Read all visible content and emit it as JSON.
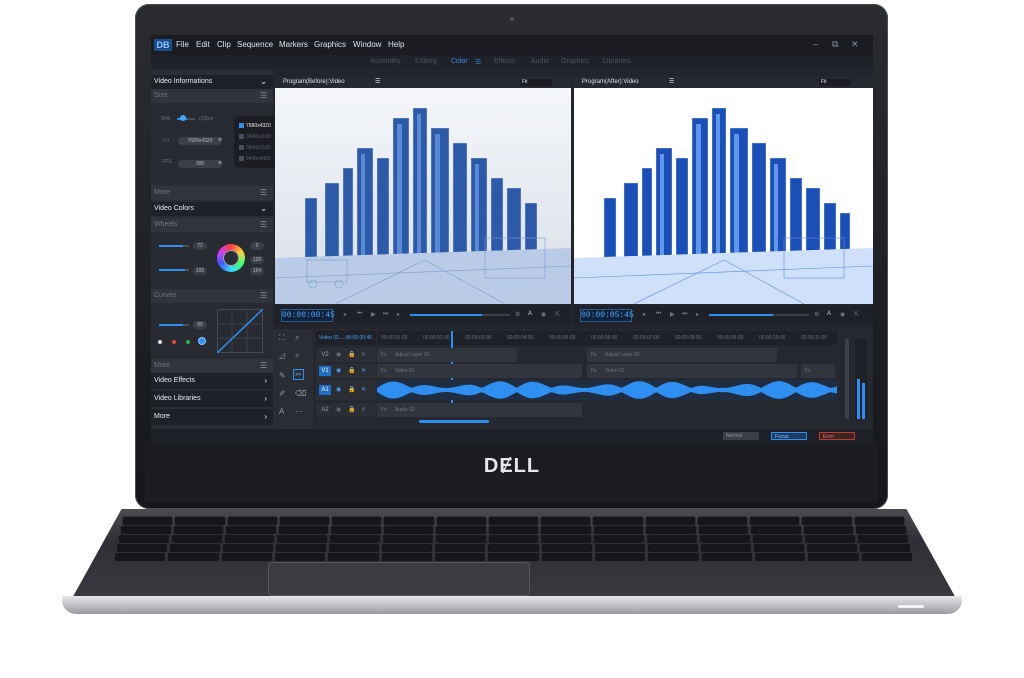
{
  "device": {
    "brand": "DɆLL"
  },
  "app": {
    "logo": "DB",
    "menu": [
      "File",
      "Edit",
      "Clip",
      "Sequence",
      "Markers",
      "Graphics",
      "Window",
      "Help"
    ],
    "window_controls": {
      "minimize": "–",
      "restore": "⧉",
      "close": "✕"
    }
  },
  "workspaces": {
    "tabs": [
      "Assembly",
      "Editing",
      "Color",
      "Effects",
      "Audio",
      "Graphics",
      "Libraries"
    ],
    "active": "Color"
  },
  "left_panel": {
    "video_informations": "Video Informations",
    "size_label": "Size",
    "toggle_left": "8/4k",
    "toggle_right": "(3)0ns",
    "resolution_value": "7680x4320",
    "fps_value": "300",
    "resolution_options": [
      "7680x4320",
      "3840x2160",
      "3840x2160",
      "5440x4400"
    ],
    "more_1": "More",
    "video_colors": "Video Colors",
    "wheels_label": "Wheels",
    "wheel_values": [
      "72",
      "0",
      "100",
      "120",
      "164"
    ],
    "curves_label": "Curves",
    "curve_value": "80",
    "more_2": "More",
    "video_effects": "Video Effects",
    "video_libraries": "Video Libraries",
    "more_3": "More"
  },
  "monitors": {
    "before": {
      "title": "Program(Before):Video",
      "fit": "Fit",
      "timecode": "00:00:00:45"
    },
    "after": {
      "title": "Program(After):Video",
      "fit": "Fit",
      "timecode": "00:00:05:45"
    }
  },
  "timeline": {
    "sequence_label": "Video 02.....00:00:00:45",
    "ruler": [
      "00:00:01:00",
      "00:00:02:00",
      "00:00:03:00",
      "00:00:04:00",
      "00:00:05:00",
      "00:00:06:00",
      "00:00:07:00",
      "00:00:08:00",
      "00:00:09:00",
      "00:00:10:00",
      "00:00:11:00"
    ],
    "tracks": [
      {
        "name": "V2",
        "active": false,
        "clips": [
          {
            "fx": "Fx",
            "label": "Adjust Layer 01"
          },
          {
            "fx": "Fx",
            "label": "Adjust Layer 02"
          }
        ]
      },
      {
        "name": "V1",
        "active": true,
        "clips": [
          {
            "fx": "Fx",
            "label": "Video 01"
          },
          {
            "fx": "Fx",
            "label": "Video 02"
          },
          {
            "fx": "Fx",
            "label": ""
          }
        ]
      },
      {
        "name": "A1",
        "active": true,
        "clips": []
      },
      {
        "name": "A2",
        "active": false,
        "clips": [
          {
            "fx": "Fx",
            "label": "Audio 02"
          }
        ]
      }
    ]
  },
  "status_buttons": [
    "Normal",
    "Focus",
    "Error"
  ],
  "colors": {
    "accent": "#2f8ff0",
    "panel": "#2a2d34",
    "normal": "#3a3f48",
    "focus": "#1f6fc9",
    "error": "#c0392b"
  }
}
